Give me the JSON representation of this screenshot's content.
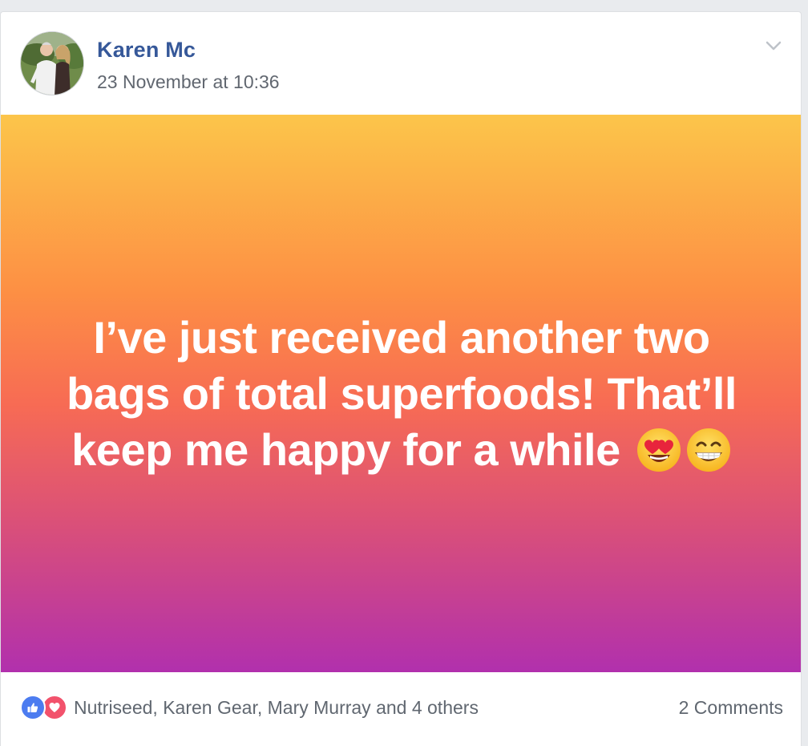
{
  "post": {
    "author": "Karen Mc",
    "timestamp": "23 November at 10:36",
    "text": "I’ve just received another two bags of total superfoods! That’ll keep me happy for a while",
    "emojis": [
      "heart-eyes-face",
      "grinning-face-with-smiling-eyes"
    ],
    "background_gradient": [
      "#fcc54a",
      "#fd8f44",
      "#f76b54",
      "#d94f7a",
      "#b130ad"
    ]
  },
  "footer": {
    "reactions": [
      "like",
      "love"
    ],
    "reactors_text": "Nutriseed, Karen Gear, Mary Murray and 4 others",
    "comments_text": "2 Comments"
  },
  "colors": {
    "author_link": "#365899",
    "meta_text": "#616770",
    "like_blue": "#4c7cf0",
    "love_red": "#f2526c"
  }
}
